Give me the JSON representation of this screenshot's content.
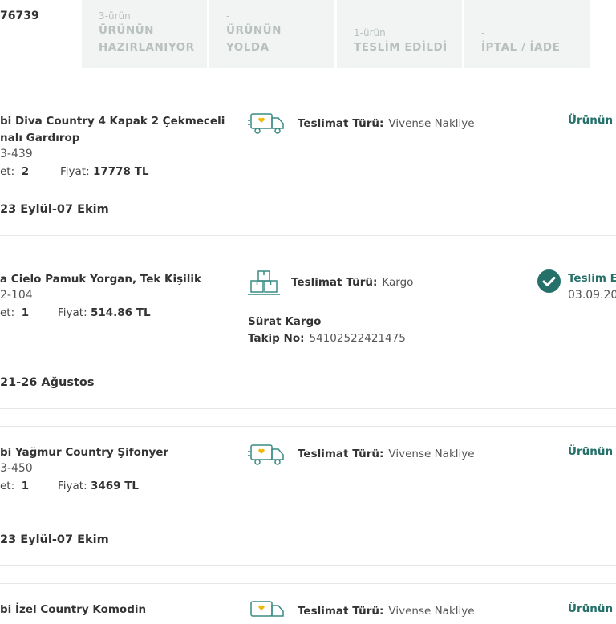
{
  "order": {
    "number": "76739"
  },
  "status_tabs": [
    {
      "count": "3-ürün",
      "line1": "ÜRÜNÜN",
      "line2": "HAZIRLANIYOR"
    },
    {
      "count": "-",
      "line1": "ÜRÜNÜN",
      "line2": "YOLDA"
    },
    {
      "count": "1-ürün",
      "line1": "",
      "line2": "TESLİM EDİLDİ"
    },
    {
      "count": "-",
      "line1": "",
      "line2": "İPTAL / İADE"
    }
  ],
  "labels": {
    "shipping_type": "Teslimat Türü:",
    "quantity": "et:",
    "price": "Fiyat:",
    "tracking": "Takip No:"
  },
  "items": [
    {
      "name_line1": "bi Diva Country 4 Kapak 2 Çekmeceli",
      "name_line2": "nalı Gardırop",
      "code": "3-439",
      "qty": "2",
      "price": "17778 TL",
      "delivery_range": "23 Eylül-07 Ekim",
      "shipping_type": "Vivense Nakliye",
      "status_text": "Ürünün h",
      "icon": "truck-icon"
    },
    {
      "name_line1": "a Cielo Pamuk Yorgan, Tek Kişilik",
      "name_line2": "",
      "code": "2-104",
      "qty": "1",
      "price": "514.86 TL",
      "delivery_range": "21-26 Ağustos",
      "shipping_type": "Kargo",
      "carrier": "Sürat Kargo",
      "tracking_no": "54102522421475",
      "status_text": "Teslim Ed",
      "status_date": "03.09.20",
      "icon": "boxes-icon"
    },
    {
      "name_line1": "bi Yağmur Country Şifonyer",
      "name_line2": "",
      "code": "3-450",
      "qty": "1",
      "price": "3469 TL",
      "delivery_range": "23 Eylül-07 Ekim",
      "shipping_type": "Vivense Nakliye",
      "status_text": "Ürünün h",
      "icon": "truck-icon"
    },
    {
      "name_line1": "bi İzel Country Komodin",
      "shipping_type": "Vivense Nakliye",
      "status_text": "Ürünün h",
      "icon": "truck-icon"
    }
  ],
  "colors": {
    "accent": "#26706a",
    "tab_bg": "#f1f4f3",
    "tab_text": "#b9c1bf",
    "truck_stroke": "#3a8b84",
    "heart": "#f2b705"
  }
}
